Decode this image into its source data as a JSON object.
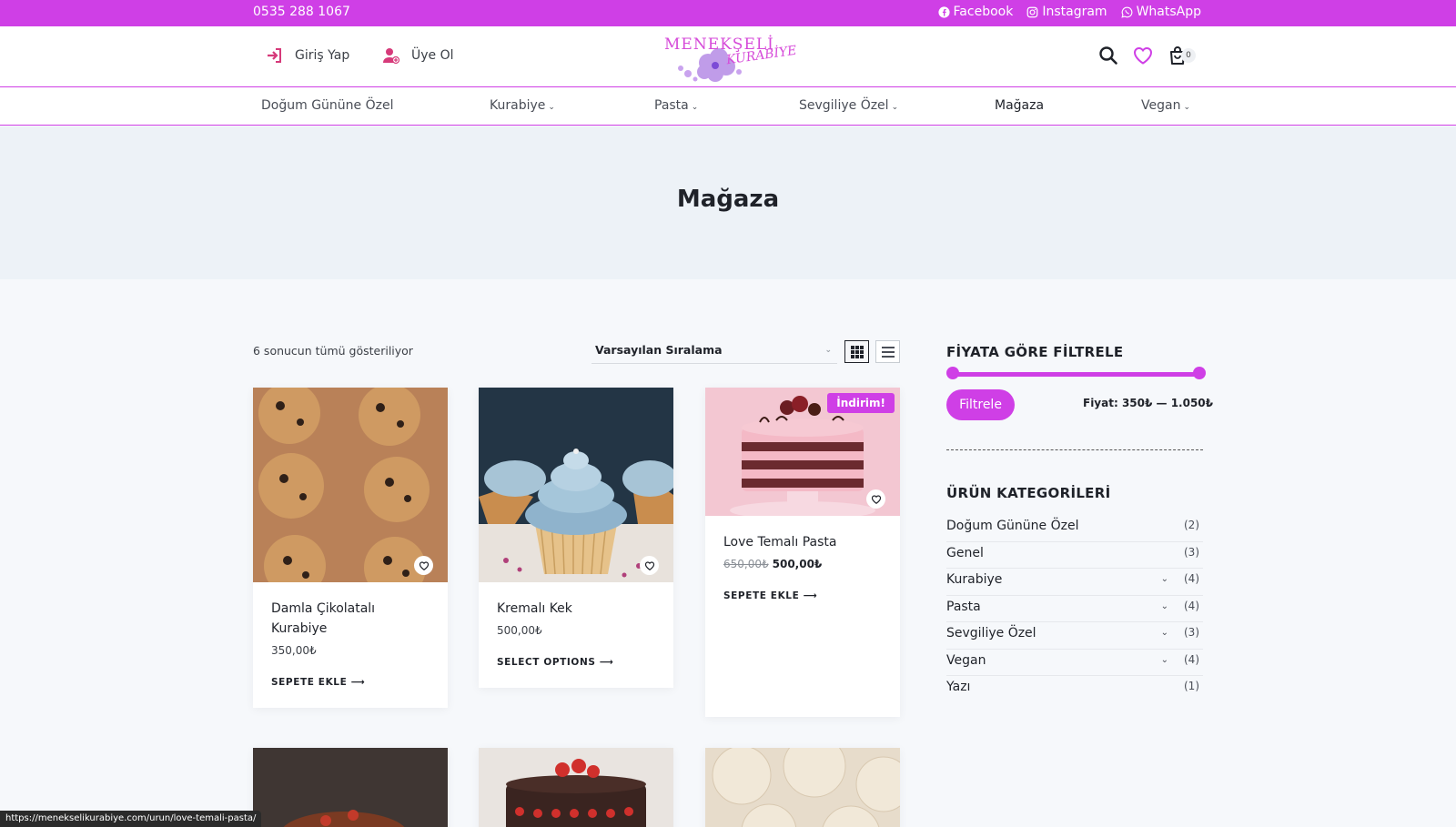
{
  "topbar": {
    "phone": "0535 288 1067",
    "social": [
      {
        "label": "Facebook",
        "icon": "facebook-icon"
      },
      {
        "label": "Instagram",
        "icon": "instagram-icon"
      },
      {
        "label": "WhatsApp",
        "icon": "whatsapp-icon"
      }
    ]
  },
  "header": {
    "login_label": "Giriş Yap",
    "register_label": "Üye Ol",
    "logo_line1": "MENEKŞELİ",
    "logo_line2": "KURABİYE",
    "cart_count": "0"
  },
  "nav": {
    "items": [
      {
        "label": "Doğum Gününe Özel",
        "has_menu": false
      },
      {
        "label": "Kurabiye",
        "has_menu": true
      },
      {
        "label": "Pasta",
        "has_menu": true
      },
      {
        "label": "Sevgiliye Özel",
        "has_menu": true
      },
      {
        "label": "Mağaza",
        "has_menu": false
      },
      {
        "label": "Vegan",
        "has_menu": true
      }
    ]
  },
  "page_title": "Mağaza",
  "shop": {
    "result_count": "6 sonucun tümü gösteriliyor",
    "sort_value": "Varsayılan Sıralama"
  },
  "products": [
    {
      "name": "Damla Çikolatalı Kurabiye",
      "price": "350,00₺",
      "cta": "SEPETE EKLE"
    },
    {
      "name": "Kremalı Kek",
      "price": "500,00₺",
      "cta": "SELECT OPTIONS"
    },
    {
      "name": "Love Temalı Pasta",
      "old_price": "650,00₺",
      "price": "500,00₺",
      "badge": "İndirim!",
      "cta": "SEPETE EKLE"
    }
  ],
  "sidebar": {
    "price_filter_title": "FİYATA GÖRE FİLTRELE",
    "filter_button": "Filtrele",
    "price_range": "Fiyat: 350₺ — 1.050₺",
    "categories_title": "ÜRÜN KATEGORİLERİ",
    "categories": [
      {
        "name": "Doğum Gününe Özel",
        "count": "(2)",
        "expandable": false
      },
      {
        "name": "Genel",
        "count": "(3)",
        "expandable": false
      },
      {
        "name": "Kurabiye",
        "count": "(4)",
        "expandable": true
      },
      {
        "name": "Pasta",
        "count": "(4)",
        "expandable": true
      },
      {
        "name": "Sevgiliye Özel",
        "count": "(3)",
        "expandable": true
      },
      {
        "name": "Vegan",
        "count": "(4)",
        "expandable": true
      },
      {
        "name": "Yazı",
        "count": "(1)",
        "expandable": false
      }
    ]
  },
  "status_url": "https://menekselikurabiye.com/urun/love-temali-pasta/",
  "colors": {
    "accent": "#cf3fe6",
    "hero_bg": "#edf2f7",
    "page_bg": "#f6f8fb"
  }
}
